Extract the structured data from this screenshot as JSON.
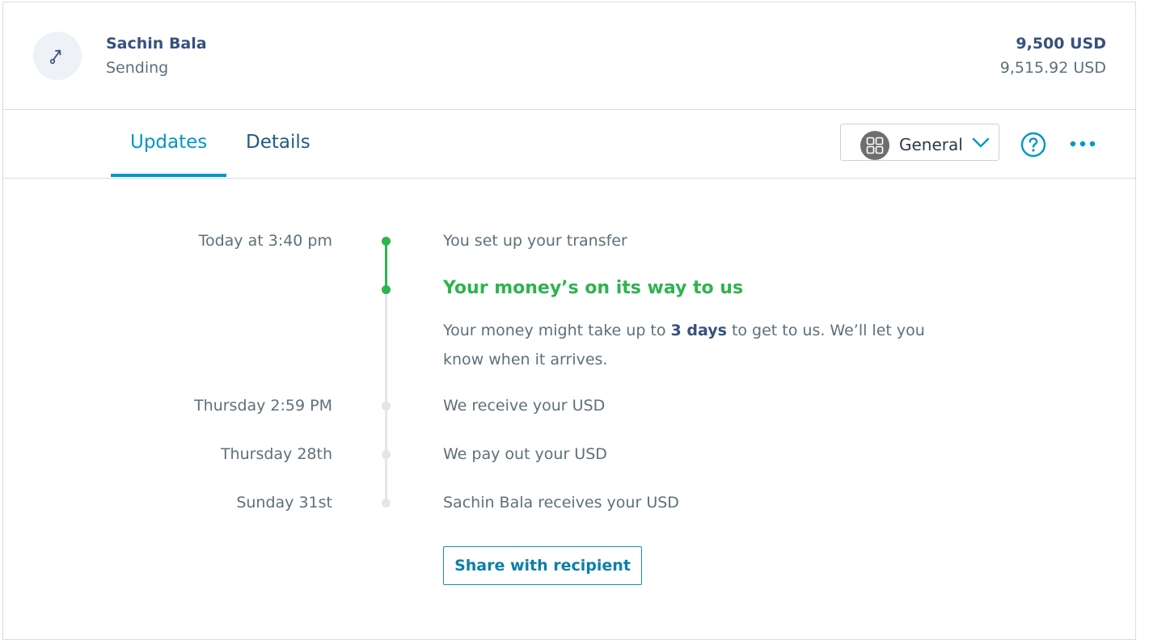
{
  "header": {
    "recipient_name": "Sachin Bala",
    "status": "Sending",
    "amount": "9,500 USD",
    "amount_total": "9,515.92 USD",
    "icon": "send-arrow-icon"
  },
  "tabs": {
    "updates_label": "Updates",
    "details_label": "Details",
    "active": "Updates"
  },
  "account_select": {
    "label": "General",
    "icon": "grid-icon"
  },
  "timeline": {
    "step1": {
      "time": "Today at 3:40 pm",
      "text": "You set up your transfer"
    },
    "current": {
      "title": "Your money’s on its way to us",
      "desc_before": "Your money might take up to ",
      "desc_bold": "3 days",
      "desc_after": " to get to us. We’ll let you know when it arrives."
    },
    "step3": {
      "time": "Thursday 2:59 PM",
      "text": "We receive your USD"
    },
    "step4": {
      "time": "Thursday 28th",
      "text": "We pay out your USD"
    },
    "step5": {
      "time": "Sunday 31st",
      "text": "Sachin Bala receives your USD"
    }
  },
  "share_button": "Share with recipient",
  "colors": {
    "accent": "#0097c7",
    "success": "#2eb44e",
    "text_primary": "#37517e",
    "text_secondary": "#5d7079"
  }
}
